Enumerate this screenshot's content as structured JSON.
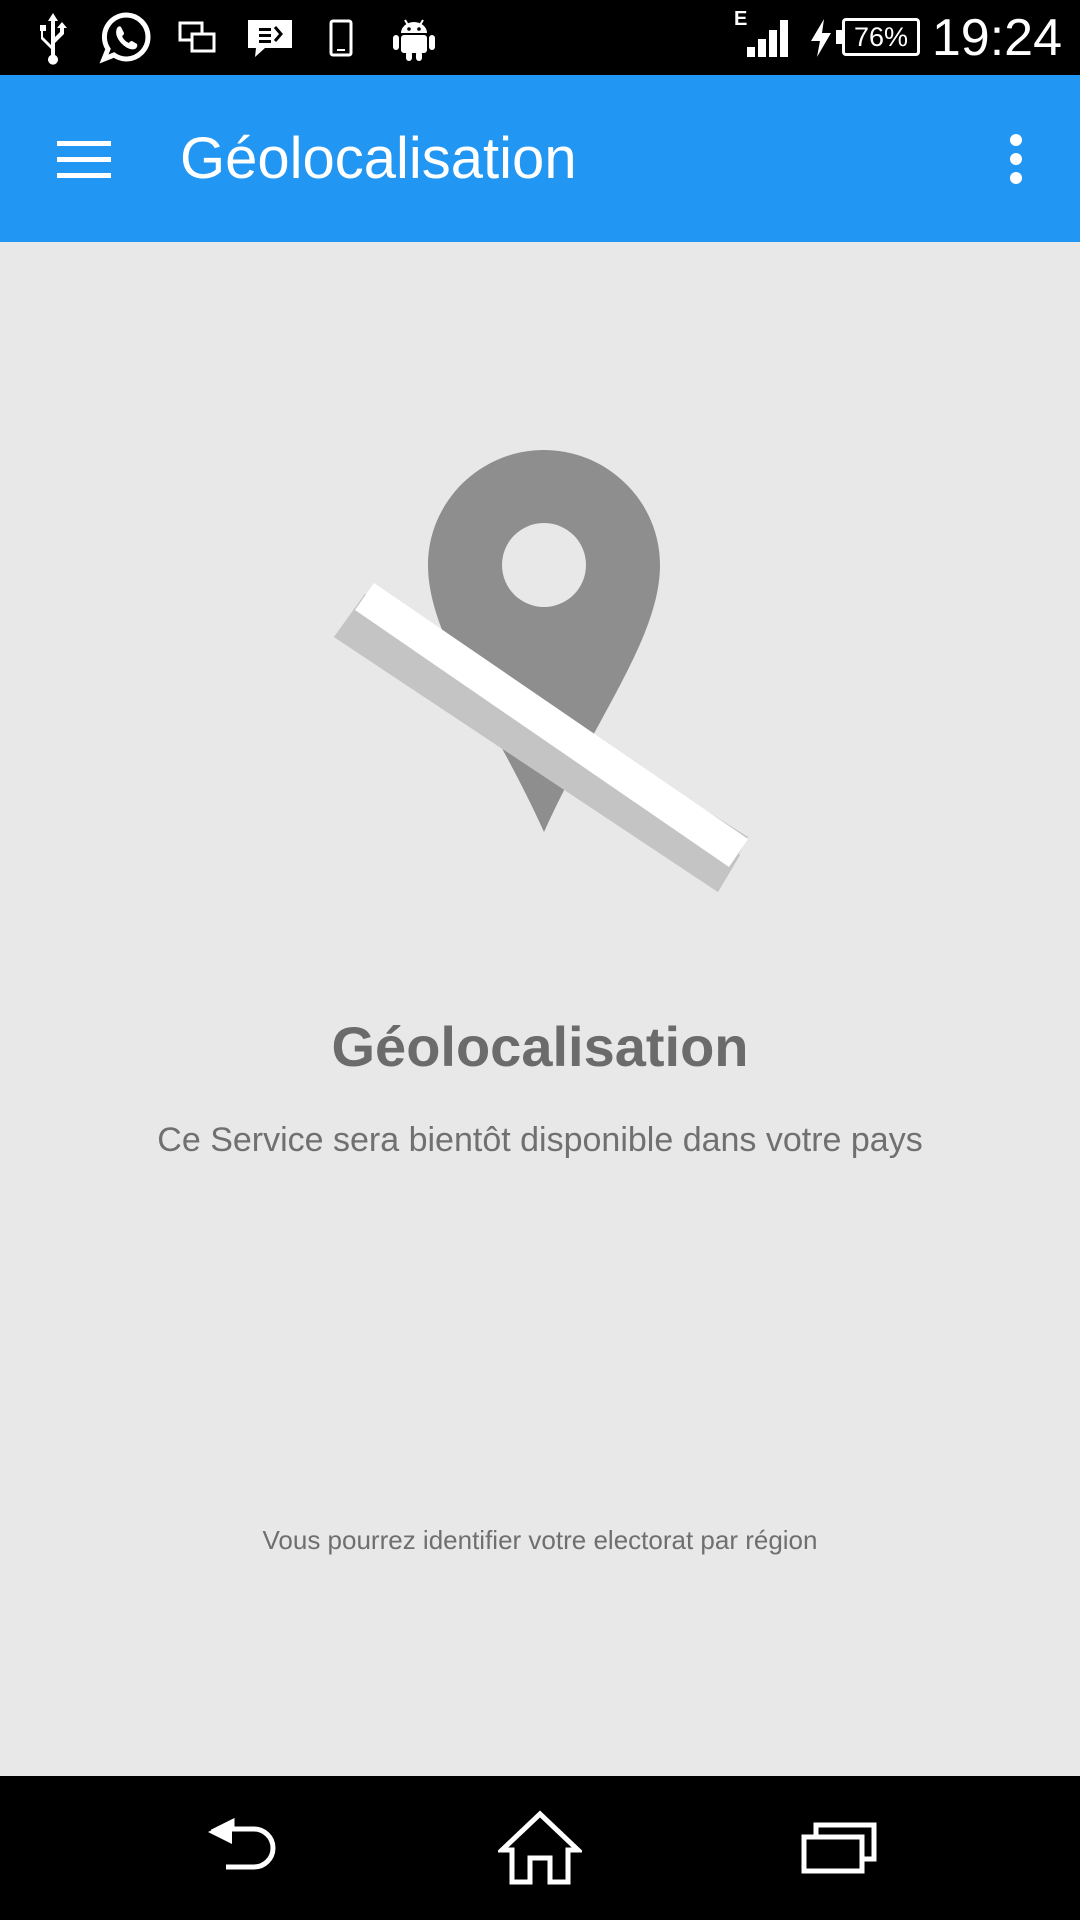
{
  "status_bar": {
    "network_type": "E",
    "battery_level": "76%",
    "time": "19:24",
    "icons": [
      "usb-icon",
      "whatsapp-icon",
      "screen-mirror-icon",
      "sms-icon",
      "phone-device-icon",
      "android-icon",
      "signal-icon",
      "charging-icon",
      "battery-icon"
    ]
  },
  "app_bar": {
    "title": "Géolocalisation",
    "menu_icon": "hamburger-menu-icon",
    "overflow_icon": "more-vert-icon",
    "background_color": "#2196f3"
  },
  "content": {
    "illustration_icon": "location-off-icon",
    "headline": "Géolocalisation",
    "subtitle": "Ce Service sera bientôt disponible dans votre pays",
    "footnote": "Vous pourrez identifier votre electorat par région"
  },
  "nav_bar": {
    "icons": [
      "back-icon",
      "home-icon",
      "recents-icon"
    ]
  }
}
